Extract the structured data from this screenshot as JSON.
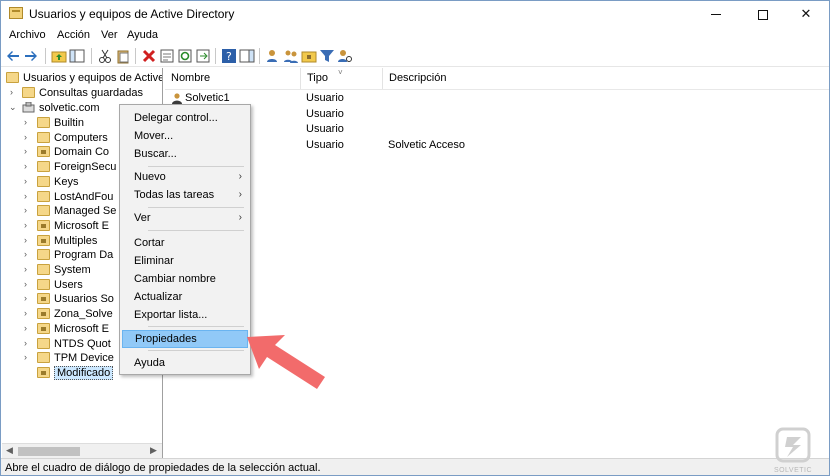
{
  "window": {
    "title": "Usuarios y equipos de Active Directory"
  },
  "menubar": {
    "items": [
      "Archivo",
      "Acción",
      "Ver",
      "Ayuda"
    ]
  },
  "tree": {
    "root": "Usuarios y equipos de Active Directory",
    "saved_queries": "Consultas guardadas",
    "domain": "solvetic.com",
    "items": [
      {
        "label": "Builtin",
        "type": "container"
      },
      {
        "label": "Computers",
        "type": "container"
      },
      {
        "label": "Domain Co",
        "type": "ou"
      },
      {
        "label": "ForeignSecu",
        "type": "container"
      },
      {
        "label": "Keys",
        "type": "container"
      },
      {
        "label": "LostAndFou",
        "type": "container"
      },
      {
        "label": "Managed Se",
        "type": "container"
      },
      {
        "label": "Microsoft E",
        "type": "ou"
      },
      {
        "label": "Multiples",
        "type": "ou"
      },
      {
        "label": "Program Da",
        "type": "container"
      },
      {
        "label": "System",
        "type": "container"
      },
      {
        "label": "Users",
        "type": "container"
      },
      {
        "label": "Usuarios So",
        "type": "ou"
      },
      {
        "label": "Zona_Solve",
        "type": "ou"
      },
      {
        "label": "Microsoft E",
        "type": "ou"
      },
      {
        "label": "NTDS Quot",
        "type": "container"
      },
      {
        "label": "TPM Device",
        "type": "container"
      },
      {
        "label": "Modificado",
        "type": "ou",
        "selected": true
      }
    ]
  },
  "list": {
    "columns": [
      "Nombre",
      "Tipo",
      "Descripción"
    ],
    "rows": [
      {
        "name": "Solvetic1",
        "type": "Usuario",
        "description": ""
      },
      {
        "name": "",
        "type": "Usuario",
        "description": ""
      },
      {
        "name": "",
        "type": "Usuario",
        "description": ""
      },
      {
        "name": "",
        "type": "Usuario",
        "description": "Solvetic Acceso"
      }
    ]
  },
  "context_menu": {
    "delegate": "Delegar control...",
    "move": "Mover...",
    "find": "Buscar...",
    "new": "Nuevo",
    "all_tasks": "Todas las tareas",
    "view": "Ver",
    "cut": "Cortar",
    "delete": "Eliminar",
    "rename": "Cambiar nombre",
    "refresh": "Actualizar",
    "export": "Exportar lista...",
    "properties": "Propiedades",
    "help": "Ayuda"
  },
  "status": {
    "text": "Abre el cuadro de diálogo de propiedades de la selección actual."
  },
  "watermark": {
    "text": "SOLVETIC"
  },
  "colors": {
    "highlight": "#91c9f7",
    "pointer": "#f26b6b",
    "folder": "#f5d789"
  }
}
